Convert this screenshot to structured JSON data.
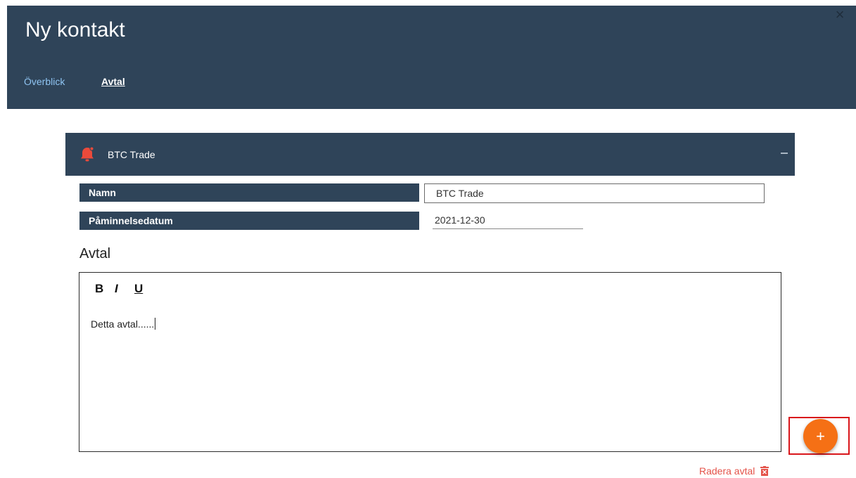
{
  "header": {
    "title": "Ny kontakt",
    "close_glyph": "×",
    "tabs": [
      {
        "label": "Överblick",
        "active": false
      },
      {
        "label": "Avtal",
        "active": true
      }
    ]
  },
  "agreement_panel": {
    "icon": "bell-alert-icon",
    "title": "BTC Trade",
    "collapse_icon": "minus-icon"
  },
  "form": {
    "name_label": "Namn",
    "name_value": "BTC Trade",
    "reminder_label": "Påminnelsedatum",
    "reminder_value": "2021-12-30"
  },
  "editor": {
    "heading": "Avtal",
    "toolbar": {
      "bold": "B",
      "italic": "I",
      "underline": "U"
    },
    "content": "Detta avtal......"
  },
  "actions": {
    "add_glyph": "+",
    "delete_label": "Radera avtal",
    "delete_icon": "trash-icon"
  },
  "colors": {
    "header_bg": "#2f4459",
    "tab_link": "#8fc4f2",
    "accent_orange": "#f57015",
    "delete_red": "#e45249",
    "highlight_red": "#d9161b"
  }
}
